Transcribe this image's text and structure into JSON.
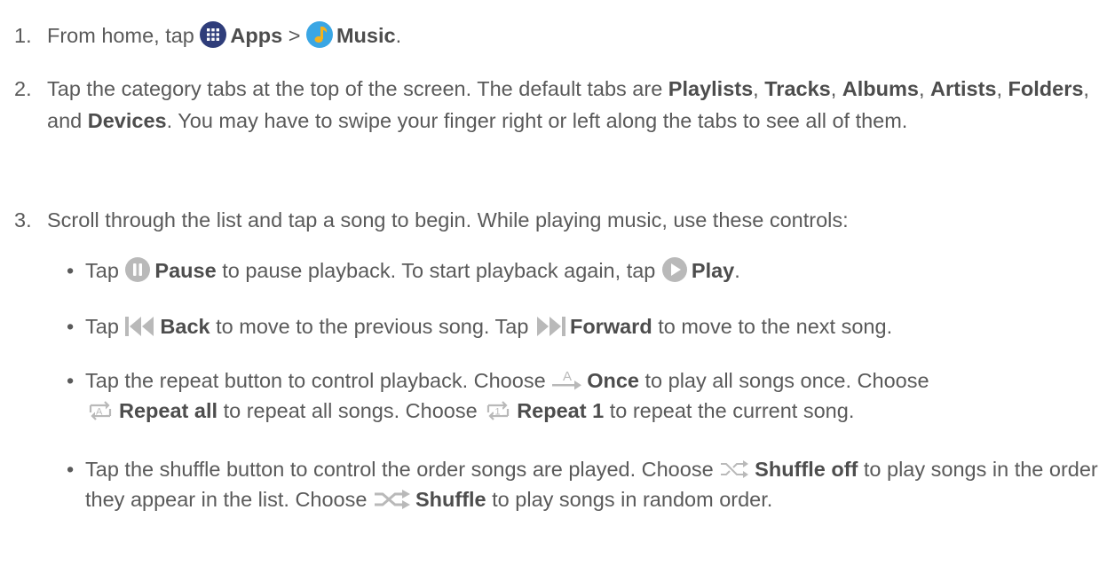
{
  "steps": [
    {
      "num": "1.",
      "s1": "From home, tap",
      "apps": "Apps",
      "s2": ">",
      "music": "Music",
      "s3": "."
    },
    {
      "num": "2.",
      "s1": "Tap the category tabs at the top of the screen. The default tabs are",
      "playlists": "Playlists",
      "c1": ",",
      "tracks": "Tracks",
      "c2": ",",
      "albums": "Albums",
      "c3": ",",
      "artists": "Artists",
      "c4": ",",
      "folders": "Folders",
      "c5": ", and",
      "devices": "Devices",
      "s2": ". You may have to swipe your finger right or left along the tabs to see all of them."
    },
    {
      "num": "3.",
      "text": "Scroll through the list and tap a song to begin. While playing music, use these controls:"
    }
  ],
  "bullets": [
    {
      "t1": "Tap",
      "pause": "Pause",
      "t2": "to pause playback. To start playback again, tap",
      "play": "Play",
      "t3": "."
    },
    {
      "t1": "Tap",
      "back": "Back",
      "t2": "to move to the previous song. Tap",
      "forward": "Forward",
      "t3": "to move to the next song."
    },
    {
      "t1": "Tap the repeat button to control playback. Choose",
      "once": "Once",
      "t2": "to play all songs once. Choose",
      "repeat_all": "Repeat all",
      "t3": "to repeat all songs. Choose",
      "repeat_1": "Repeat 1",
      "t4": "to repeat the current song."
    },
    {
      "t1": "Tap the shuffle button to control the order songs are played. Choose",
      "shuffle_off": "Shuffle off",
      "t2": "to play songs in the order they appear in the list. Choose",
      "shuffle": "Shuffle",
      "t3": "to play songs in random order."
    }
  ],
  "icons": {
    "apps": "apps-icon",
    "music": "music-icon",
    "pause": "pause-icon",
    "play": "play-icon",
    "back": "back-icon",
    "forward": "forward-icon",
    "once": "once-icon",
    "repeat_all": "repeat-all-icon",
    "repeat_1": "repeat-one-icon",
    "shuffle_off": "shuffle-off-icon",
    "shuffle": "shuffle-icon",
    "bullet": "bullet-dot"
  },
  "colors": {
    "text": "#5a5a5a",
    "bold_text": "#4d4d4d",
    "apps_icon": "#2f3d7a",
    "music_icon_bg": "#3aa6e4",
    "music_note": "#f5b21d",
    "media_icon": "#b9b9b9"
  }
}
